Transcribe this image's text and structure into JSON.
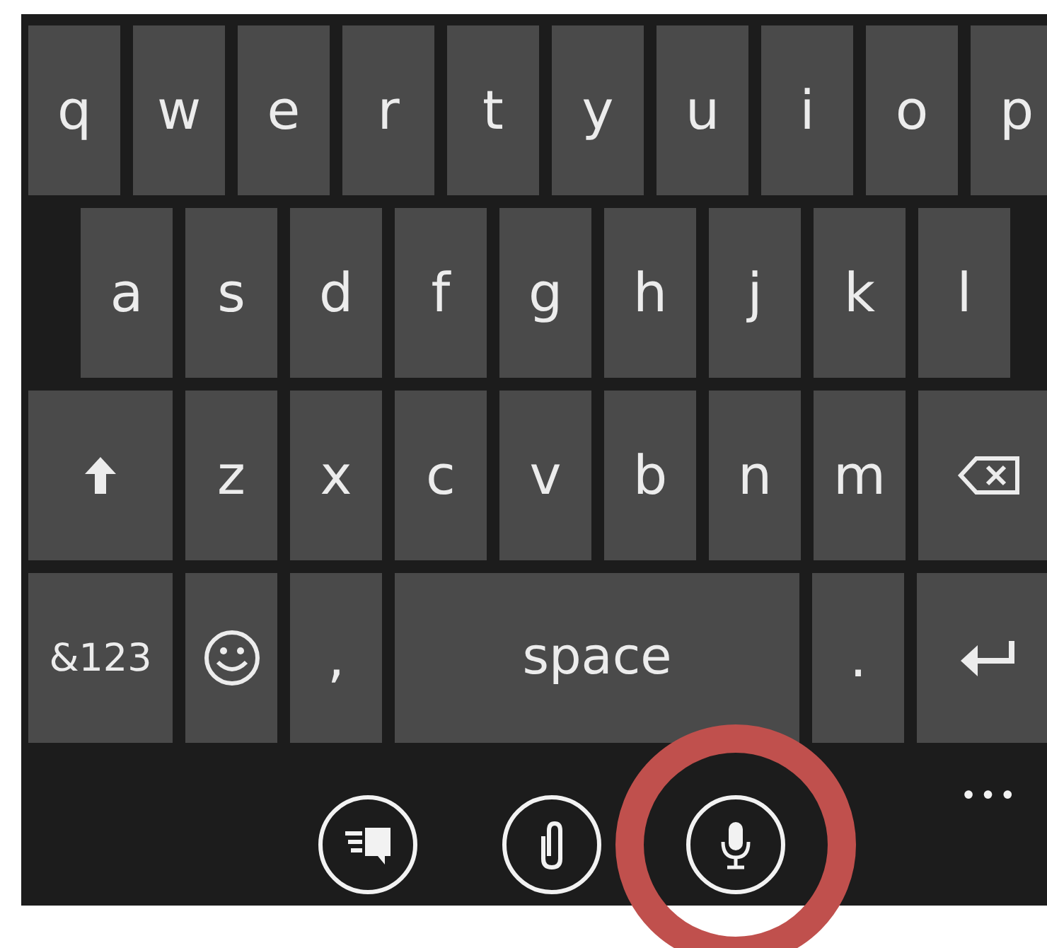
{
  "keyboard": {
    "rows": [
      {
        "keys": [
          {
            "kind": "letter",
            "label": "q"
          },
          {
            "kind": "letter",
            "label": "w"
          },
          {
            "kind": "letter",
            "label": "e"
          },
          {
            "kind": "letter",
            "label": "r"
          },
          {
            "kind": "letter",
            "label": "t"
          },
          {
            "kind": "letter",
            "label": "y"
          },
          {
            "kind": "letter",
            "label": "u"
          },
          {
            "kind": "letter",
            "label": "i"
          },
          {
            "kind": "letter",
            "label": "o"
          },
          {
            "kind": "letter",
            "label": "p"
          }
        ]
      },
      {
        "keys": [
          {
            "kind": "letter",
            "label": "a"
          },
          {
            "kind": "letter",
            "label": "s"
          },
          {
            "kind": "letter",
            "label": "d"
          },
          {
            "kind": "letter",
            "label": "f"
          },
          {
            "kind": "letter",
            "label": "g"
          },
          {
            "kind": "letter",
            "label": "h"
          },
          {
            "kind": "letter",
            "label": "j"
          },
          {
            "kind": "letter",
            "label": "k"
          },
          {
            "kind": "letter",
            "label": "l"
          }
        ]
      },
      {
        "keys": [
          {
            "kind": "shift"
          },
          {
            "kind": "letter",
            "label": "z"
          },
          {
            "kind": "letter",
            "label": "x"
          },
          {
            "kind": "letter",
            "label": "c"
          },
          {
            "kind": "letter",
            "label": "v"
          },
          {
            "kind": "letter",
            "label": "b"
          },
          {
            "kind": "letter",
            "label": "n"
          },
          {
            "kind": "letter",
            "label": "m"
          },
          {
            "kind": "backspace"
          }
        ]
      },
      {
        "keys": [
          {
            "kind": "symbols",
            "label": "&123"
          },
          {
            "kind": "emoji"
          },
          {
            "kind": "letter",
            "label": ","
          },
          {
            "kind": "space",
            "label": "space"
          },
          {
            "kind": "letter",
            "label": "."
          },
          {
            "kind": "enter"
          }
        ]
      }
    ]
  },
  "app_bar": {
    "buttons": [
      {
        "kind": "message",
        "highlighted": false
      },
      {
        "kind": "attach",
        "highlighted": false
      },
      {
        "kind": "microphone",
        "highlighted": true
      }
    ],
    "more": "•••"
  }
}
